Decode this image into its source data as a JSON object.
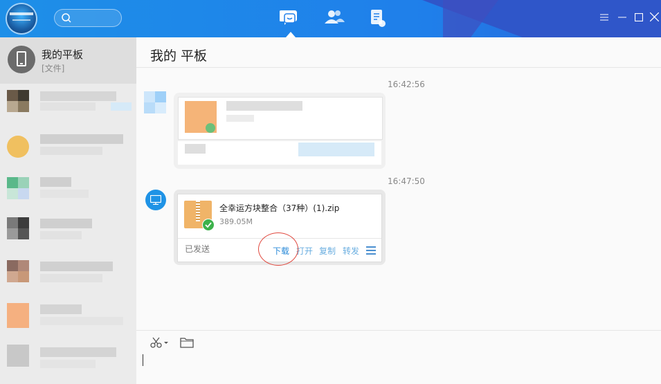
{
  "header": {
    "search_placeholder": "",
    "nav": [
      {
        "name": "messages-tab-icon",
        "active": true
      },
      {
        "name": "contacts-tab-icon",
        "active": false
      },
      {
        "name": "files-tab-icon",
        "active": false
      }
    ]
  },
  "sidebar": {
    "active_contact": {
      "name": "我的平板",
      "subtitle": "[文件]"
    }
  },
  "chat": {
    "title": "我的 平板",
    "timestamps": [
      "16:42:56",
      "16:47:50"
    ],
    "file_message": {
      "filename": "全幸运方块整合（37种）(1).zip",
      "size": "389.05M",
      "status": "已发送",
      "actions": [
        "下载",
        "打开",
        "复制",
        "转发"
      ]
    }
  },
  "colors": {
    "header_blue": "#1f7fea",
    "accent": "#2a8ad8",
    "check_green": "#3db24b",
    "annotation_red": "#e0483e"
  }
}
